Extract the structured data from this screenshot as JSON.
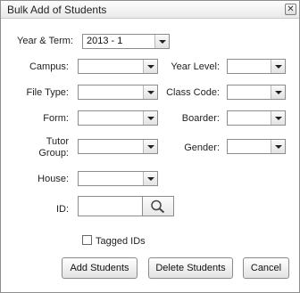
{
  "dialog": {
    "title": "Bulk Add of Students",
    "close_glyph": "✕"
  },
  "fields": {
    "year_term": {
      "label": "Year & Term:",
      "value": "2013 - 1"
    },
    "campus": {
      "label": "Campus:",
      "value": ""
    },
    "year_level": {
      "label": "Year Level:",
      "value": ""
    },
    "file_type": {
      "label": "File Type:",
      "value": ""
    },
    "class_code": {
      "label": "Class Code:",
      "value": ""
    },
    "form": {
      "label": "Form:",
      "value": ""
    },
    "boarder": {
      "label": "Boarder:",
      "value": ""
    },
    "tutor_group": {
      "label_line1": "Tutor",
      "label_line2": "Group:",
      "value": ""
    },
    "gender": {
      "label": "Gender:",
      "value": ""
    },
    "house": {
      "label": "House:",
      "value": ""
    },
    "id": {
      "label": "ID:",
      "value": ""
    },
    "tagged_ids": {
      "label": "Tagged IDs",
      "checked": false
    }
  },
  "buttons": {
    "add": "Add Students",
    "delete": "Delete Students",
    "cancel": "Cancel"
  }
}
